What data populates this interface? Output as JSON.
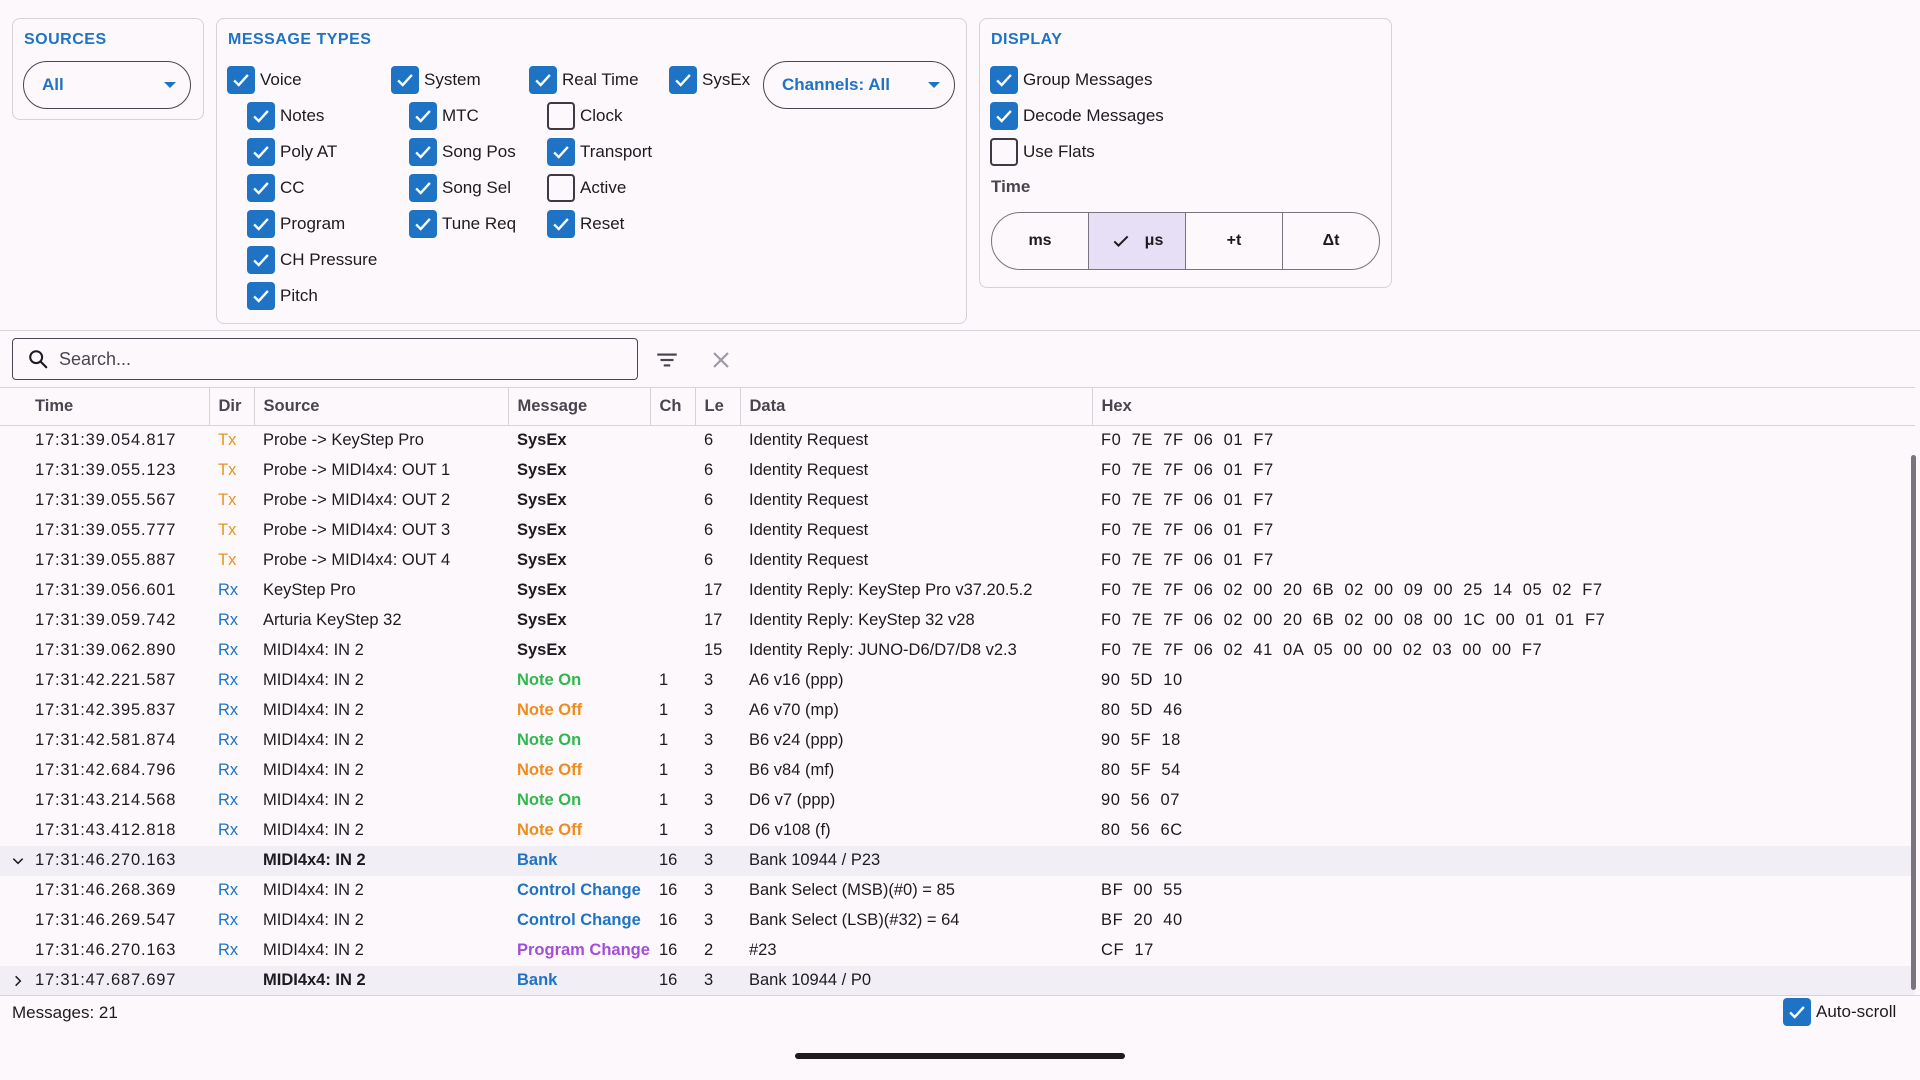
{
  "sources": {
    "title": "SOURCES",
    "selected": "All"
  },
  "message_types": {
    "title": "MESSAGE TYPES",
    "channels_dropdown": "Channels: All",
    "items": [
      {
        "label": "Voice",
        "checked": true
      },
      {
        "label": "Notes",
        "checked": true
      },
      {
        "label": "Poly AT",
        "checked": true
      },
      {
        "label": "CC",
        "checked": true
      },
      {
        "label": "Program",
        "checked": true
      },
      {
        "label": "CH Pressure",
        "checked": true
      },
      {
        "label": "Pitch",
        "checked": true
      },
      {
        "label": "System",
        "checked": true
      },
      {
        "label": "MTC",
        "checked": true
      },
      {
        "label": "Song Pos",
        "checked": true
      },
      {
        "label": "Song Sel",
        "checked": true
      },
      {
        "label": "Tune Req",
        "checked": true
      },
      {
        "label": "Real Time",
        "checked": true
      },
      {
        "label": "Clock",
        "checked": false
      },
      {
        "label": "Transport",
        "checked": true
      },
      {
        "label": "Active",
        "checked": false
      },
      {
        "label": "Reset",
        "checked": true
      },
      {
        "label": "SysEx",
        "checked": true
      }
    ]
  },
  "display": {
    "title": "DISPLAY",
    "items": [
      {
        "label": "Group Messages",
        "checked": true
      },
      {
        "label": "Decode Messages",
        "checked": true
      },
      {
        "label": "Use Flats",
        "checked": false
      }
    ],
    "time_label": "Time",
    "time_options": [
      {
        "label": "ms",
        "selected": false
      },
      {
        "label": "μs",
        "selected": true
      },
      {
        "label": "+t",
        "selected": false
      },
      {
        "label": "Δt",
        "selected": false
      }
    ]
  },
  "search": {
    "placeholder": "Search...",
    "value": ""
  },
  "table": {
    "columns": [
      "Time",
      "Dir",
      "Source",
      "Message",
      "Ch",
      "Le",
      "Data",
      "Hex"
    ],
    "rows": [
      {
        "time": "17:31:39.054.817",
        "dir": "Tx",
        "source": "Probe -> KeyStep Pro",
        "message": "SysEx",
        "kind": "sysex",
        "ch": "",
        "len": "6",
        "data": "Identity Request",
        "hex": "F0 7E 7F 06 01 F7"
      },
      {
        "time": "17:31:39.055.123",
        "dir": "Tx",
        "source": "Probe -> MIDI4x4: OUT 1",
        "message": "SysEx",
        "kind": "sysex",
        "ch": "",
        "len": "6",
        "data": "Identity Request",
        "hex": "F0 7E 7F 06 01 F7"
      },
      {
        "time": "17:31:39.055.567",
        "dir": "Tx",
        "source": "Probe -> MIDI4x4: OUT 2",
        "message": "SysEx",
        "kind": "sysex",
        "ch": "",
        "len": "6",
        "data": "Identity Request",
        "hex": "F0 7E 7F 06 01 F7"
      },
      {
        "time": "17:31:39.055.777",
        "dir": "Tx",
        "source": "Probe -> MIDI4x4: OUT 3",
        "message": "SysEx",
        "kind": "sysex",
        "ch": "",
        "len": "6",
        "data": "Identity Request",
        "hex": "F0 7E 7F 06 01 F7"
      },
      {
        "time": "17:31:39.055.887",
        "dir": "Tx",
        "source": "Probe -> MIDI4x4: OUT 4",
        "message": "SysEx",
        "kind": "sysex",
        "ch": "",
        "len": "6",
        "data": "Identity Request",
        "hex": "F0 7E 7F 06 01 F7"
      },
      {
        "time": "17:31:39.056.601",
        "dir": "Rx",
        "source": "KeyStep Pro",
        "message": "SysEx",
        "kind": "sysex",
        "ch": "",
        "len": "17",
        "data": "Identity Reply: KeyStep Pro v37.20.5.2",
        "hex": "F0 7E 7F 06 02 00 20 6B 02 00 09 00 25 14 05 02 F7"
      },
      {
        "time": "17:31:39.059.742",
        "dir": "Rx",
        "source": "Arturia KeyStep 32",
        "message": "SysEx",
        "kind": "sysex",
        "ch": "",
        "len": "17",
        "data": "Identity Reply: KeyStep 32 v28",
        "hex": "F0 7E 7F 06 02 00 20 6B 02 00 08 00 1C 00 01 01 F7"
      },
      {
        "time": "17:31:39.062.890",
        "dir": "Rx",
        "source": "MIDI4x4: IN 2",
        "message": "SysEx",
        "kind": "sysex",
        "ch": "",
        "len": "15",
        "data": "Identity Reply: JUNO-D6/D7/D8 v2.3",
        "hex": "F0 7E 7F 06 02 41 0A 05 00 00 02 03 00 00 F7"
      },
      {
        "time": "17:31:42.221.587",
        "dir": "Rx",
        "source": "MIDI4x4: IN 2",
        "message": "Note On",
        "kind": "on",
        "ch": "1",
        "len": "3",
        "data": "A6 v16 (ppp)",
        "hex": "90 5D 10"
      },
      {
        "time": "17:31:42.395.837",
        "dir": "Rx",
        "source": "MIDI4x4: IN 2",
        "message": "Note Off",
        "kind": "off",
        "ch": "1",
        "len": "3",
        "data": "A6 v70 (mp)",
        "hex": "80 5D 46"
      },
      {
        "time": "17:31:42.581.874",
        "dir": "Rx",
        "source": "MIDI4x4: IN 2",
        "message": "Note On",
        "kind": "on",
        "ch": "1",
        "len": "3",
        "data": "B6 v24 (ppp)",
        "hex": "90 5F 18"
      },
      {
        "time": "17:31:42.684.796",
        "dir": "Rx",
        "source": "MIDI4x4: IN 2",
        "message": "Note Off",
        "kind": "off",
        "ch": "1",
        "len": "3",
        "data": "B6 v84 (mf)",
        "hex": "80 5F 54"
      },
      {
        "time": "17:31:43.214.568",
        "dir": "Rx",
        "source": "MIDI4x4: IN 2",
        "message": "Note On",
        "kind": "on",
        "ch": "1",
        "len": "3",
        "data": "D6 v7 (ppp)",
        "hex": "90 56 07"
      },
      {
        "time": "17:31:43.412.818",
        "dir": "Rx",
        "source": "MIDI4x4: IN 2",
        "message": "Note Off",
        "kind": "off",
        "ch": "1",
        "len": "3",
        "data": "D6 v108 (f)",
        "hex": "80 56 6C"
      },
      {
        "time": "17:31:46.270.163",
        "dir": "",
        "source": "MIDI4x4: IN 2",
        "message": "Bank",
        "kind": "bank",
        "ch": "16",
        "len": "3",
        "data": "Bank 10944 / P23",
        "hex": "",
        "group": "expanded"
      },
      {
        "time": "17:31:46.268.369",
        "dir": "Rx",
        "source": "MIDI4x4: IN 2",
        "message": "Control Change",
        "kind": "cc",
        "ch": "16",
        "len": "3",
        "data": "Bank Select (MSB)(#0) = 85",
        "hex": "BF 00 55"
      },
      {
        "time": "17:31:46.269.547",
        "dir": "Rx",
        "source": "MIDI4x4: IN 2",
        "message": "Control Change",
        "kind": "cc",
        "ch": "16",
        "len": "3",
        "data": "Bank Select (LSB)(#32) = 64",
        "hex": "BF 20 40"
      },
      {
        "time": "17:31:46.270.163",
        "dir": "Rx",
        "source": "MIDI4x4: IN 2",
        "message": "Program Change",
        "kind": "pc",
        "ch": "16",
        "len": "2",
        "data": "#23",
        "hex": "CF 17"
      },
      {
        "time": "17:31:47.687.697",
        "dir": "",
        "source": "MIDI4x4: IN 2",
        "message": "Bank",
        "kind": "bank",
        "ch": "16",
        "len": "3",
        "data": "Bank 10944 / P0",
        "hex": "",
        "group": "collapsed"
      }
    ]
  },
  "footer": {
    "status": "Messages: 21",
    "autoscroll_label": "Auto-scroll",
    "autoscroll_checked": true
  },
  "colors": {
    "accent": "#1e73c4",
    "tx": "#e69520",
    "note_on": "#2fb84d",
    "note_off": "#f08c1a",
    "program_change": "#a14fd8"
  }
}
